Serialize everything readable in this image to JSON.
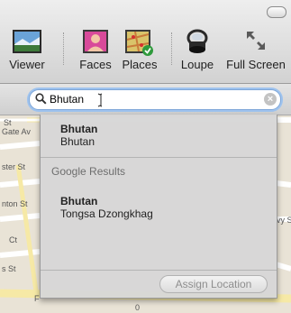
{
  "toolbar": {
    "buttons": {
      "viewer": "Viewer",
      "faces": "Faces",
      "places": "Places",
      "loupe": "Loupe",
      "full_screen": "Full Screen"
    }
  },
  "search": {
    "value": "Bhutan"
  },
  "results": {
    "local": {
      "title": "Bhutan",
      "subtitle": "Bhutan"
    },
    "section_header": "Google Results",
    "google": {
      "title": "Bhutan",
      "subtitle": "Tongsa Dzongkhag"
    }
  },
  "footer": {
    "assign_label": "Assign Location"
  },
  "map": {
    "streets": [
      "Gate Av",
      "ster St",
      "nton St",
      "Ct",
      "s St",
      "vy S"
    ],
    "street_bits": [
      "St",
      "F",
      "0"
    ]
  },
  "colors": {
    "focus_ring": "#9fc3ee",
    "map_bg": "#e9e3d6",
    "road": "#f6e9a6",
    "dropdown_bg": "#d6d6d6"
  }
}
